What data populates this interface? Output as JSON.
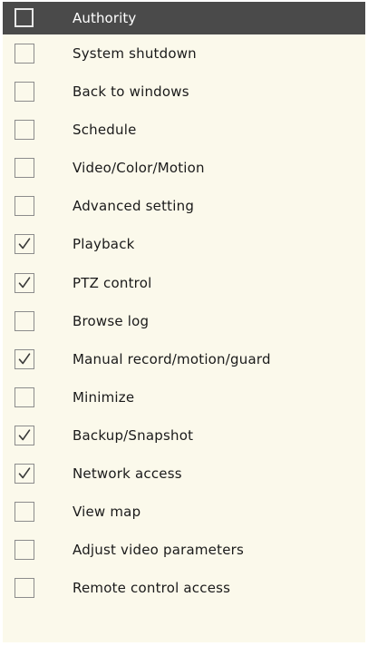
{
  "header": {
    "label": "Authority",
    "checked": false
  },
  "items": [
    {
      "label": "System shutdown",
      "checked": false
    },
    {
      "label": "Back to windows",
      "checked": false
    },
    {
      "label": "Schedule",
      "checked": false
    },
    {
      "label": "Video/Color/Motion",
      "checked": false
    },
    {
      "label": "Advanced setting",
      "checked": false
    },
    {
      "label": "Playback",
      "checked": true
    },
    {
      "label": "PTZ control",
      "checked": true
    },
    {
      "label": "Browse log",
      "checked": false
    },
    {
      "label": "Manual record/motion/guard",
      "checked": true
    },
    {
      "label": "Minimize",
      "checked": false
    },
    {
      "label": "Backup/Snapshot",
      "checked": true
    },
    {
      "label": "Network access",
      "checked": true
    },
    {
      "label": "View map",
      "checked": false
    },
    {
      "label": "Adjust video parameters",
      "checked": false
    },
    {
      "label": "Remote control access",
      "checked": false
    }
  ],
  "icons": {
    "checkbox": "checkbox-icon",
    "checkmark": "checkmark-icon"
  },
  "colors": {
    "header_bg": "#4a4a4a",
    "row_bg": "#fbf9eb",
    "text": "#1a1a1a",
    "checkbox_border": "#8c8c8c",
    "checkmark": "#3a3a3a"
  }
}
